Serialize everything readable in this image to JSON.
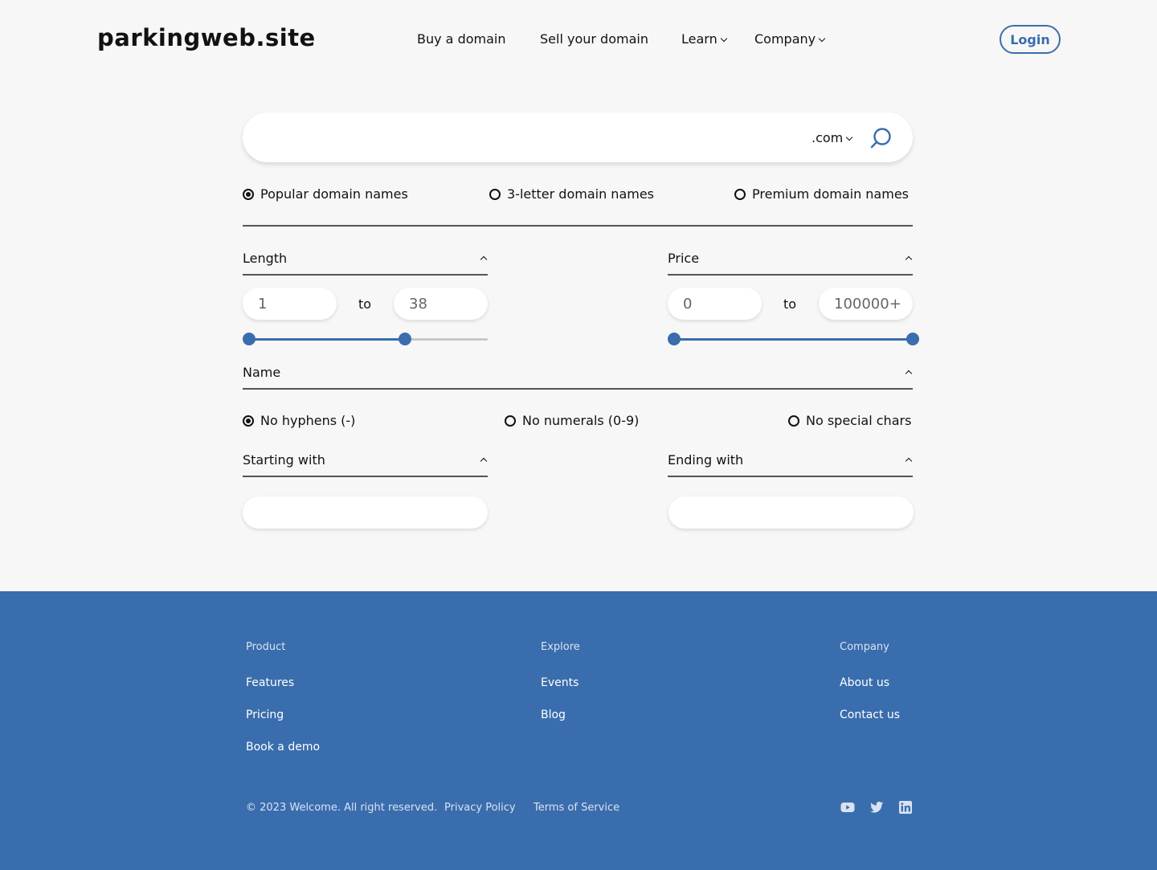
{
  "header": {
    "logo": "parkingweb.site",
    "nav": {
      "buy": "Buy a domain",
      "sell": "Sell your domain",
      "learn": "Learn",
      "company": "Company"
    },
    "login": "Login"
  },
  "search": {
    "value": "",
    "tld": ".com"
  },
  "domain_types": {
    "popular": "Popular domain names",
    "three_letter": "3-letter domain names",
    "premium": "Premium domain names",
    "selected": "popular"
  },
  "filters": {
    "length": {
      "label": "Length",
      "min": "1",
      "max": "38",
      "to": "to",
      "slider_min_fraction": 0,
      "slider_max_fraction": 0.64
    },
    "price": {
      "label": "Price",
      "min": "0",
      "max": "100000+",
      "to": "to",
      "slider_min_fraction": 0,
      "slider_max_fraction": 1
    },
    "name": {
      "label": "Name",
      "no_hyphens": "No hyphens (-)",
      "no_numerals": "No numerals (0-9)",
      "no_special": "No special chars",
      "selected": "no_hyphens"
    },
    "starting_with": {
      "label": "Starting with",
      "value": ""
    },
    "ending_with": {
      "label": "Ending with",
      "value": ""
    }
  },
  "footer": {
    "product": {
      "heading": "Product",
      "features": "Features",
      "pricing": "Pricing",
      "book_demo": "Book a demo"
    },
    "explore": {
      "heading": "Explore",
      "events": "Events",
      "blog": "Blog"
    },
    "company": {
      "heading": "Company",
      "about": "About us",
      "contact": "Contact us"
    },
    "copyright": "© 2023 Welcome. All right reserved.",
    "privacy": "Privacy Policy",
    "terms": "Terms of Service",
    "social": [
      "youtube-icon",
      "twitter-icon",
      "linkedin-icon"
    ]
  },
  "colors": {
    "accent": "#3a6dad",
    "background": "#f7f7f7"
  }
}
